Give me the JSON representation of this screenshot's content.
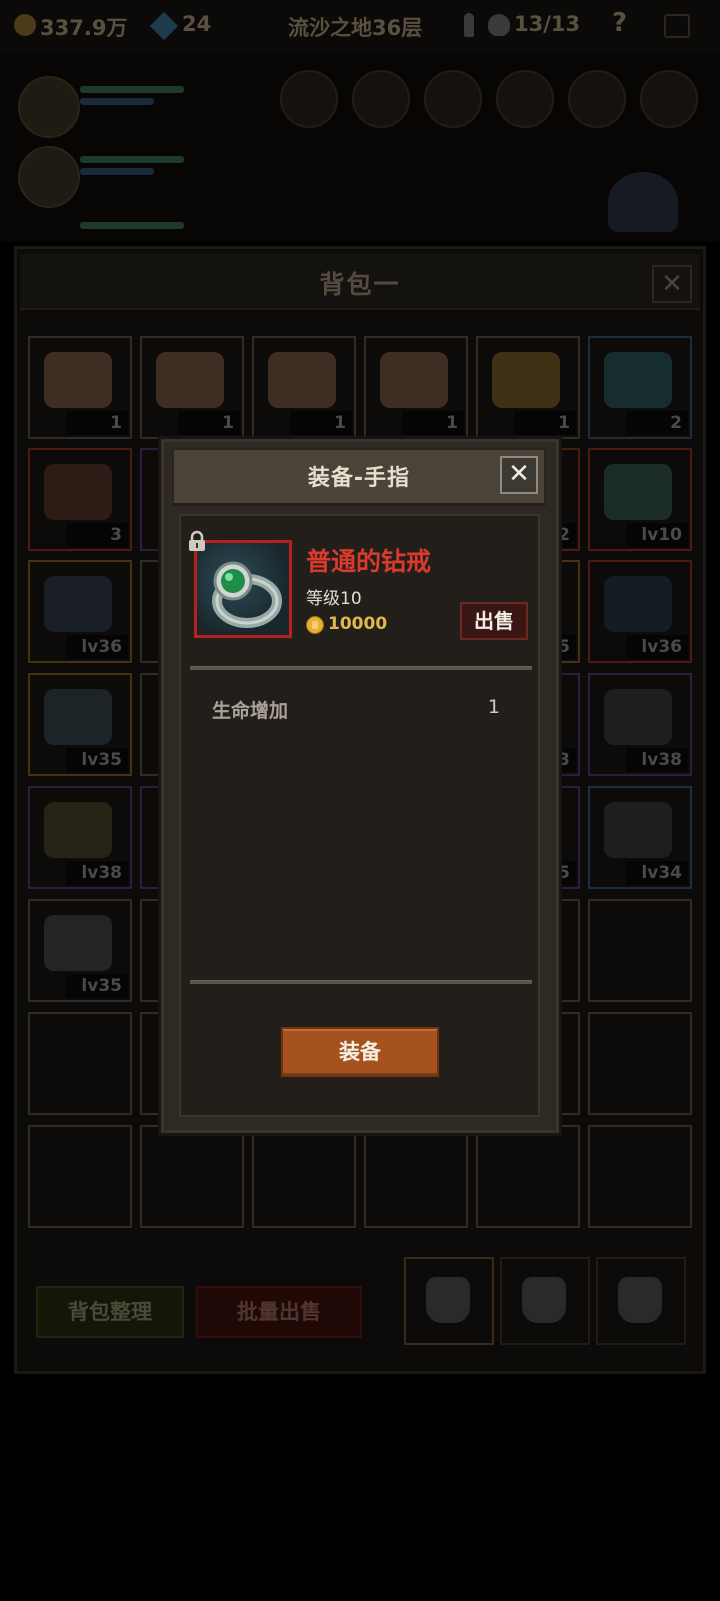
{
  "topbar": {
    "gold": "337.9万",
    "gems": "24",
    "location": "流沙之地36层",
    "party": "13/13",
    "help": "?"
  },
  "bag": {
    "title": "背包一",
    "close_icon": "close-icon",
    "sort_button": "背包整理",
    "bulk_sell_button": "批量出售",
    "tab_count": 3,
    "slots": [
      {
        "badge": "1",
        "rarity": "normal",
        "icon": "cake-icon",
        "color": "#6a4a3a"
      },
      {
        "badge": "1",
        "rarity": "normal",
        "icon": "cake-icon",
        "color": "#6a4a3a"
      },
      {
        "badge": "1",
        "rarity": "normal",
        "icon": "cake-icon",
        "color": "#6a4a3a"
      },
      {
        "badge": "1",
        "rarity": "normal",
        "icon": "cake-icon",
        "color": "#6a4a3a"
      },
      {
        "badge": "1",
        "rarity": "normal",
        "icon": "beer-mug-icon",
        "color": "#6a5020"
      },
      {
        "badge": "2",
        "rarity": "blue",
        "icon": "potion-bottle-icon",
        "color": "#1e4a4a"
      },
      {
        "badge": "3",
        "rarity": "red",
        "icon": "bomb-icon",
        "color": "#4a2a20"
      },
      {
        "badge": "",
        "rarity": "purple",
        "icon": "",
        "color": ""
      },
      {
        "badge": "",
        "rarity": "normal",
        "icon": "",
        "color": ""
      },
      {
        "badge": "",
        "rarity": "normal",
        "icon": "",
        "color": ""
      },
      {
        "badge": "2",
        "rarity": "red",
        "icon": "",
        "color": ""
      },
      {
        "badge": "lv10",
        "rarity": "red",
        "icon": "ring-icon",
        "color": "#2a4a40"
      },
      {
        "badge": "lv36",
        "rarity": "orange",
        "icon": "axe-icon",
        "color": "#25323a"
      },
      {
        "badge": "",
        "rarity": "normal",
        "icon": "",
        "color": ""
      },
      {
        "badge": "",
        "rarity": "normal",
        "icon": "",
        "color": ""
      },
      {
        "badge": "",
        "rarity": "normal",
        "icon": "",
        "color": ""
      },
      {
        "badge": "5",
        "rarity": "orange",
        "icon": "",
        "color": ""
      },
      {
        "badge": "lv36",
        "rarity": "red",
        "icon": "armor-icon",
        "color": "#1e2a36"
      },
      {
        "badge": "lv35",
        "rarity": "orange",
        "icon": "spear-icon",
        "color": "#2a3a40"
      },
      {
        "badge": "",
        "rarity": "normal",
        "icon": "",
        "color": ""
      },
      {
        "badge": "",
        "rarity": "normal",
        "icon": "",
        "color": ""
      },
      {
        "badge": "",
        "rarity": "normal",
        "icon": "",
        "color": ""
      },
      {
        "badge": "3",
        "rarity": "purple",
        "icon": "",
        "color": ""
      },
      {
        "badge": "lv38",
        "rarity": "purple",
        "icon": "helmet-icon",
        "color": "#303030"
      },
      {
        "badge": "lv38",
        "rarity": "purple",
        "icon": "shield-icon",
        "color": "#3a3a20"
      },
      {
        "badge": "",
        "rarity": "purple",
        "icon": "",
        "color": ""
      },
      {
        "badge": "",
        "rarity": "normal",
        "icon": "",
        "color": ""
      },
      {
        "badge": "",
        "rarity": "normal",
        "icon": "",
        "color": ""
      },
      {
        "badge": "5",
        "rarity": "purple",
        "icon": "",
        "color": ""
      },
      {
        "badge": "lv34",
        "rarity": "blue",
        "icon": "helmet-icon",
        "color": "#303030"
      },
      {
        "badge": "lv35",
        "rarity": "normal",
        "icon": "sword-icon",
        "color": "#3a3a3a"
      },
      {
        "badge": "",
        "rarity": "empty",
        "icon": "",
        "color": ""
      },
      {
        "badge": "",
        "rarity": "empty",
        "icon": "",
        "color": ""
      },
      {
        "badge": "",
        "rarity": "empty",
        "icon": "",
        "color": ""
      },
      {
        "badge": "",
        "rarity": "empty",
        "icon": "",
        "color": ""
      },
      {
        "badge": "",
        "rarity": "empty",
        "icon": "",
        "color": ""
      },
      {
        "badge": "",
        "rarity": "empty",
        "icon": "",
        "color": ""
      },
      {
        "badge": "",
        "rarity": "empty",
        "icon": "",
        "color": ""
      },
      {
        "badge": "",
        "rarity": "empty",
        "icon": "",
        "color": ""
      },
      {
        "badge": "",
        "rarity": "empty",
        "icon": "",
        "color": ""
      },
      {
        "badge": "",
        "rarity": "empty",
        "icon": "",
        "color": ""
      },
      {
        "badge": "",
        "rarity": "empty",
        "icon": "",
        "color": ""
      },
      {
        "badge": "",
        "rarity": "empty",
        "icon": "",
        "color": ""
      },
      {
        "badge": "",
        "rarity": "empty",
        "icon": "",
        "color": ""
      },
      {
        "badge": "",
        "rarity": "empty",
        "icon": "",
        "color": ""
      },
      {
        "badge": "",
        "rarity": "empty",
        "icon": "",
        "color": ""
      },
      {
        "badge": "",
        "rarity": "empty",
        "icon": "",
        "color": ""
      },
      {
        "badge": "",
        "rarity": "empty",
        "icon": "",
        "color": ""
      }
    ]
  },
  "modal": {
    "title": "装备-手指",
    "item": {
      "name": "普通的钻戒",
      "level": "等级10",
      "price": "10000",
      "icon": "ring-icon",
      "locked_icon": "padlock-icon",
      "name_color": "#d83a2c"
    },
    "sell_button": "出售",
    "stats": [
      {
        "label": "生命增加",
        "value": "1"
      }
    ],
    "equip_button": "装备"
  }
}
